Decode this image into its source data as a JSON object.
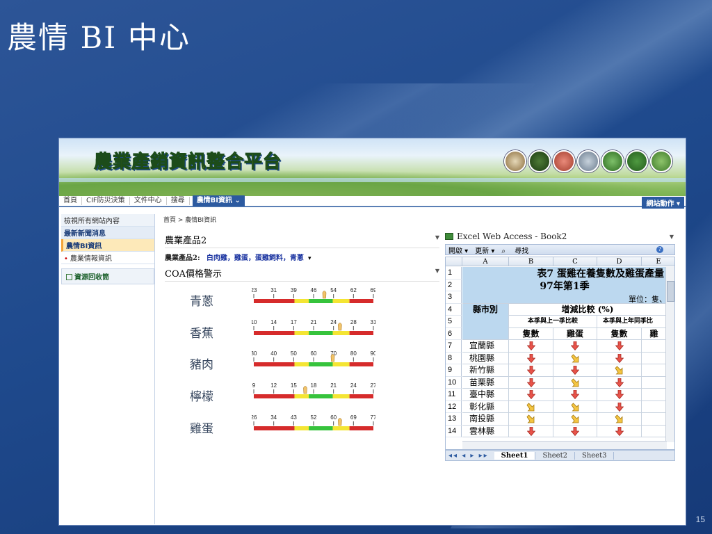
{
  "slide": {
    "title": "農情 BI 中心",
    "page_number": "15"
  },
  "portal": {
    "banner_title": "農業產銷資訊整合平台",
    "banner_icons": [
      "chicken-photo",
      "forest-photo",
      "meat-photo",
      "fish-photo",
      "vegetable-photo",
      "fruit-photo",
      "cattle-photo"
    ],
    "nav": {
      "items": [
        "首頁",
        "CIF防災決策",
        "文件中心",
        "搜尋"
      ],
      "active": "農情BI資訊 ⌄",
      "site_actions": "網站動作 ▾"
    },
    "leftnav": {
      "view_all": "檢視所有網站內容",
      "items": [
        "最新新聞消息",
        "農情BI資訊"
      ],
      "sub_item": "農業情報資訊",
      "recycle": "資源回收筒"
    },
    "breadcrumb": "首頁 > 農情BI資訊",
    "products_part": {
      "title": "農業產品2",
      "filter_label": "農業產品2:",
      "filter_value": "白肉雞，雞蛋，蛋雞飼料，青蔥",
      "filter_arrow": "▾"
    },
    "coa_part": {
      "title": "COA價格警示",
      "gauges": [
        {
          "name": "青蔥",
          "ticks": [
            "23",
            "31",
            "39",
            "46",
            "54",
            "62",
            "69"
          ],
          "marker": 0.59
        },
        {
          "name": "香蕉",
          "ticks": [
            "10",
            "14",
            "17",
            "21",
            "24",
            "28",
            "31"
          ],
          "marker": 0.72
        },
        {
          "name": "豬肉",
          "ticks": [
            "30",
            "40",
            "50",
            "60",
            "70",
            "80",
            "90"
          ],
          "marker": 0.66
        },
        {
          "name": "檸檬",
          "ticks": [
            "9",
            "12",
            "15",
            "18",
            "21",
            "24",
            "27"
          ],
          "marker": 0.43
        },
        {
          "name": "雞蛋",
          "ticks": [
            "26",
            "34",
            "43",
            "52",
            "60",
            "69",
            "77"
          ],
          "marker": 0.72
        }
      ]
    },
    "excel": {
      "title": "Excel Web Access - Book2",
      "toolbar": [
        "開啟 ▾",
        "更新 ▾",
        "尋找"
      ],
      "col_headers": [
        "A",
        "B",
        "C",
        "D",
        "E"
      ],
      "row_numbers": [
        "1",
        "2",
        "3",
        "4",
        "5",
        "6",
        "7",
        "8",
        "9",
        "10",
        "11",
        "12",
        "13",
        "14"
      ],
      "table_title": "表7  蛋雞在養隻數及雞蛋產量",
      "table_period": "97年第1季",
      "unit": "單位：隻、",
      "county_header": "縣市別",
      "change_header": "增減比較 (%)",
      "compare1": "本季與上一季比較",
      "compare2": "本季與上年同季比",
      "sub_headers": [
        "隻數",
        "雞蛋",
        "隻數",
        "雞"
      ],
      "rows": [
        {
          "county": "宜蘭縣",
          "arrows": [
            "down",
            "down",
            "down"
          ]
        },
        {
          "county": "桃園縣",
          "arrows": [
            "down",
            "diag",
            "down"
          ]
        },
        {
          "county": "新竹縣",
          "arrows": [
            "down",
            "down",
            "diag"
          ]
        },
        {
          "county": "苗栗縣",
          "arrows": [
            "down",
            "diag",
            "down"
          ]
        },
        {
          "county": "臺中縣",
          "arrows": [
            "down",
            "down",
            "down"
          ]
        },
        {
          "county": "彰化縣",
          "arrows": [
            "diag",
            "diag",
            "down"
          ]
        },
        {
          "county": "南投縣",
          "arrows": [
            "diag",
            "diag",
            "diag"
          ]
        },
        {
          "county": "雲林縣",
          "arrows": [
            "down",
            "down",
            "down"
          ]
        }
      ],
      "sheet_nav": "◂◂ ◂ ▸ ▸▸",
      "sheets": [
        "Sheet1",
        "Sheet2",
        "Sheet3"
      ]
    }
  }
}
